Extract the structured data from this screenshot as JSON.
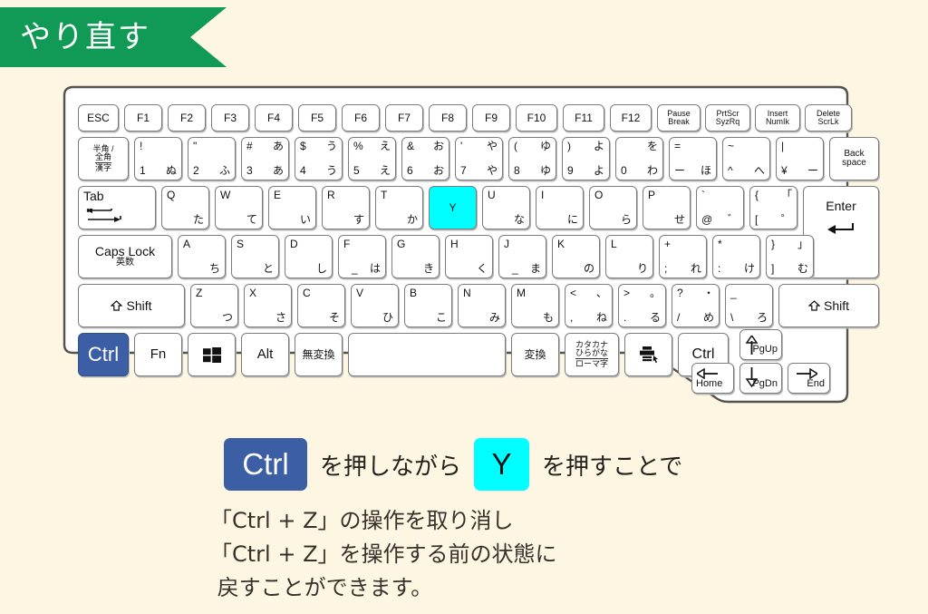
{
  "page": {
    "background_color": "#fdf6e3",
    "accent_green": "#119a55",
    "accent_blue": "#3c5ea4",
    "accent_cyan": "#00ffff"
  },
  "ribbon": {
    "title": "やり直す"
  },
  "keyboard": {
    "rows": {
      "function_row": [
        {
          "id": "esc",
          "top": "ESC"
        },
        {
          "id": "f1",
          "top": "F1"
        },
        {
          "id": "f2",
          "top": "F2"
        },
        {
          "id": "f3",
          "top": "F3"
        },
        {
          "id": "f4",
          "top": "F4"
        },
        {
          "id": "f5",
          "top": "F5"
        },
        {
          "id": "f6",
          "top": "F6"
        },
        {
          "id": "f7",
          "top": "F7"
        },
        {
          "id": "f8",
          "top": "F8"
        },
        {
          "id": "f9",
          "top": "F9"
        },
        {
          "id": "f10",
          "top": "F10"
        },
        {
          "id": "f11",
          "top": "F11"
        },
        {
          "id": "f12",
          "top": "F12"
        },
        {
          "id": "pause",
          "top": "Pause",
          "sub": "Break"
        },
        {
          "id": "prtscr",
          "top": "PrtScr",
          "sub": "SyzRq"
        },
        {
          "id": "insert",
          "top": "Insert",
          "sub": "NumIk"
        },
        {
          "id": "delete",
          "top": "Delete",
          "sub": "ScrLk"
        }
      ],
      "number_row": [
        {
          "id": "hankaku",
          "l1": "半角 /",
          "l2": "全角",
          "l3": "漢字"
        },
        {
          "id": "d1",
          "tl": "!",
          "bl": "1",
          "br": "ぬ"
        },
        {
          "id": "d2",
          "tl": "\"",
          "bl": "2",
          "br": "ふ"
        },
        {
          "id": "d3",
          "tl": "#",
          "tr": "あ",
          "bl": "3",
          "br": "あ"
        },
        {
          "id": "d4",
          "tl": "$",
          "tr": "う",
          "bl": "4",
          "br": "う"
        },
        {
          "id": "d5",
          "tl": "%",
          "tr": "え",
          "bl": "5",
          "br": "え"
        },
        {
          "id": "d6",
          "tl": "&",
          "tr": "お",
          "bl": "6",
          "br": "お"
        },
        {
          "id": "d7",
          "tl": "'",
          "tr": "や",
          "bl": "7",
          "br": "や"
        },
        {
          "id": "d8",
          "tl": "(",
          "tr": "ゆ",
          "bl": "8",
          "br": "ゆ"
        },
        {
          "id": "d9",
          "tl": ")",
          "tr": "よ",
          "bl": "9",
          "br": "よ"
        },
        {
          "id": "d0",
          "tr": "を",
          "bl": "0",
          "br": "わ"
        },
        {
          "id": "minus",
          "tl": "=",
          "bl": "ー",
          "br": "ほ"
        },
        {
          "id": "caret",
          "tl": "~",
          "bl": "^",
          "br": "へ"
        },
        {
          "id": "yen",
          "tl": "|",
          "bl": "¥",
          "br": "ー"
        },
        {
          "id": "backspace",
          "l1": "Back",
          "l2": "space"
        }
      ],
      "qwerty_row": [
        {
          "id": "tab",
          "top": "Tab",
          "icon": "tab-arrows-icon"
        },
        {
          "id": "q",
          "tl": "Q",
          "br": "た"
        },
        {
          "id": "w",
          "tl": "W",
          "br": "て"
        },
        {
          "id": "e",
          "tl": "E",
          "br": "い"
        },
        {
          "id": "r",
          "tl": "R",
          "br": "す"
        },
        {
          "id": "t",
          "tl": "T",
          "br": "か"
        },
        {
          "id": "y",
          "center": "Y",
          "highlight": "cyan"
        },
        {
          "id": "u",
          "tl": "U",
          "br": "な"
        },
        {
          "id": "i",
          "tl": "I",
          "br": "に"
        },
        {
          "id": "o",
          "tl": "O",
          "br": "ら"
        },
        {
          "id": "p",
          "tl": "P",
          "br": "せ"
        },
        {
          "id": "at",
          "tl": "`",
          "bl": "@",
          "br": "゛"
        },
        {
          "id": "brkopen",
          "tl": "{",
          "tr": "「",
          "bl": "[",
          "br": "゜"
        },
        {
          "id": "enter",
          "top": "Enter",
          "icon": "enter-arrow-icon"
        }
      ],
      "home_row": [
        {
          "id": "capslock",
          "l1": "Caps Lock",
          "l2": "英数"
        },
        {
          "id": "a",
          "tl": "A",
          "br": "ち"
        },
        {
          "id": "s",
          "tl": "S",
          "br": "と"
        },
        {
          "id": "d",
          "tl": "D",
          "br": "し"
        },
        {
          "id": "f",
          "tl": "F",
          "bl": "_",
          "br": "は"
        },
        {
          "id": "g",
          "tl": "G",
          "br": "き"
        },
        {
          "id": "h",
          "tl": "H",
          "br": "く"
        },
        {
          "id": "j",
          "tl": "J",
          "bl": "_",
          "br": "ま"
        },
        {
          "id": "k",
          "tl": "K",
          "br": "の"
        },
        {
          "id": "l",
          "tl": "L",
          "br": "り"
        },
        {
          "id": "semicolon",
          "tl": "+",
          "bl": ";",
          "br": "れ"
        },
        {
          "id": "colon",
          "tl": "*",
          "bl": ":",
          "br": "け"
        },
        {
          "id": "brkclose",
          "tl": "}",
          "tr": "」",
          "bl": "]",
          "br": "む"
        }
      ],
      "shift_row": [
        {
          "id": "lshift",
          "label": "Shift",
          "icon": "shift-arrow-icon"
        },
        {
          "id": "z",
          "tl": "Z",
          "br": "つ"
        },
        {
          "id": "x",
          "tl": "X",
          "br": "さ"
        },
        {
          "id": "c",
          "tl": "C",
          "br": "そ"
        },
        {
          "id": "v",
          "tl": "V",
          "br": "ひ"
        },
        {
          "id": "b",
          "tl": "B",
          "br": "こ"
        },
        {
          "id": "n",
          "tl": "N",
          "br": "み"
        },
        {
          "id": "m",
          "tl": "M",
          "br": "も"
        },
        {
          "id": "comma",
          "tl": "<",
          "tr": "、",
          "bl": ",",
          "br": "ね"
        },
        {
          "id": "period",
          "tl": ">",
          "tr": "。",
          "bl": ".",
          "br": "る"
        },
        {
          "id": "slash",
          "tl": "?",
          "tr": "・",
          "bl": "/",
          "br": "め"
        },
        {
          "id": "ro",
          "tl": "_",
          "bl": "\\",
          "br": "ろ"
        },
        {
          "id": "rshift",
          "label": "Shift",
          "icon": "shift-arrow-icon"
        }
      ],
      "bottom_row": [
        {
          "id": "lctrl",
          "label": "Ctrl",
          "highlight": "blue"
        },
        {
          "id": "fn",
          "label": "Fn"
        },
        {
          "id": "win",
          "icon": "windows-icon"
        },
        {
          "id": "alt",
          "label": "Alt"
        },
        {
          "id": "muhenkan",
          "label": "無変換"
        },
        {
          "id": "space",
          "label": ""
        },
        {
          "id": "henkan",
          "label": "変換"
        },
        {
          "id": "katakana",
          "l1": "カタカナ",
          "l2": "ひらがな",
          "l3": "ローマ字"
        },
        {
          "id": "menu",
          "icon": "menu-print-icon"
        },
        {
          "id": "rctrl",
          "label": "Ctrl"
        }
      ],
      "arrow_cluster": [
        {
          "id": "up",
          "label": "PgUp",
          "icon": "arrow-up-icon"
        },
        {
          "id": "left",
          "label": "Home",
          "icon": "arrow-left-icon"
        },
        {
          "id": "down",
          "label": "PgDn",
          "icon": "arrow-down-icon"
        },
        {
          "id": "right",
          "label": "End",
          "icon": "arrow-right-icon"
        }
      ]
    }
  },
  "caption": {
    "ctrl_chip": "Ctrl",
    "text_middle": "を押しながら",
    "y_chip": "Y",
    "text_end": "を押すことで"
  },
  "body_text": {
    "line1": "「Ctrl + Z」の操作を取り消し",
    "line2": "「Ctrl + Z」を操作する前の状態に",
    "line3": " 戻すことができます。"
  }
}
